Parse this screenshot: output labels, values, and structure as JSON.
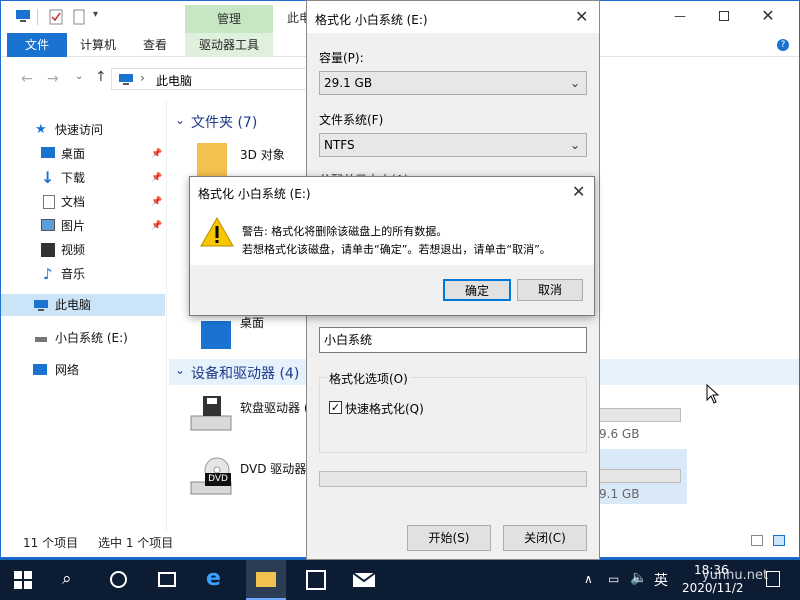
{
  "explorer": {
    "title": "此电脑",
    "manage_tab": "管理",
    "ribbon": {
      "file": "文件",
      "computer": "计算机",
      "view": "查看",
      "drive_tools": "驱动器工具"
    },
    "address": "此电脑",
    "nav": {
      "quick_access": "快速访问",
      "desktop": "桌面",
      "downloads": "下载",
      "documents": "文档",
      "pictures": "图片",
      "videos": "视频",
      "music": "音乐",
      "this_pc": "此电脑",
      "drive": "小白系统 (E:)",
      "network": "网络"
    },
    "folders_group": "文件夹 (7)",
    "folder_3d": "3D 对象",
    "folder_desktop": "桌面",
    "devices_group": "设备和驱动器 (4)",
    "floppy": "软盘驱动器 (",
    "dvd": "DVD 驱动器",
    "dvd_badge": "DVD",
    "size1": "9.6 GB",
    "size2": "9.1 GB",
    "status_items": "11 个项目",
    "status_selected": "选中 1 个项目"
  },
  "format_dialog": {
    "title": "格式化 小白系统 (E:)",
    "capacity_label": "容量(P):",
    "capacity_value": "29.1 GB",
    "fs_label": "文件系统(F)",
    "fs_value": "NTFS",
    "alloc_label": "分配单元大小(A)",
    "volume_value": "小白系统",
    "options_label": "格式化选项(O)",
    "quick_format": "快速格式化(Q)",
    "start_button": "开始(S)",
    "close_button": "关闭(C)"
  },
  "warning_dialog": {
    "title": "格式化 小白系统 (E:)",
    "line1": "警告: 格式化将删除该磁盘上的所有数据。",
    "line2": "若想格式化该磁盘，请单击“确定”。若想退出，请单击“取消”。",
    "ok_button": "确定",
    "cancel_button": "取消"
  },
  "taskbar": {
    "ime": "英",
    "time": "18:36",
    "date": "2020/11/2",
    "watermark": "yunhu.net"
  },
  "colors": {
    "accent": "#1a73d1",
    "manage": "#c7e6c4",
    "taskbar": "#0b1c33",
    "warning": "#f7c600"
  }
}
